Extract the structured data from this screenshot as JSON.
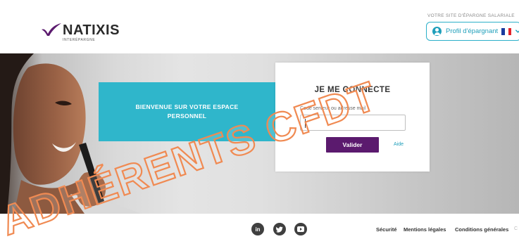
{
  "header": {
    "logo_name": "NATIXIS",
    "logo_sub": "INTERÉPARGNE",
    "site_label": "VOTRE SITE D'ÉPARGNE SALARIALE",
    "profile_label": "Profil d'épargnant",
    "profile_icon": "user-circle-icon",
    "language_flag": "flag-france-icon"
  },
  "hero": {
    "welcome_text": "BIENVENUE SUR VOTRE ESPACE PERSONNEL"
  },
  "login": {
    "title": "JE ME CONNECTE",
    "field_label": "Code serveur ou adresse mail",
    "field_value": "",
    "submit_label": "Valider",
    "help_label": "Aide"
  },
  "footer": {
    "social": [
      {
        "icon": "linkedin-icon",
        "glyph": "in"
      },
      {
        "icon": "twitter-icon",
        "glyph": "t"
      },
      {
        "icon": "youtube-icon",
        "glyph": "▶"
      }
    ],
    "links": [
      "Sécurité",
      "Mentions légales",
      "Conditions générales"
    ]
  },
  "watermark": {
    "text": "ADHÉRENTS CFDT"
  },
  "colors": {
    "accent": "#2fb6cb",
    "brand_purple": "#5b1a6e",
    "watermark": "#f08a52"
  }
}
